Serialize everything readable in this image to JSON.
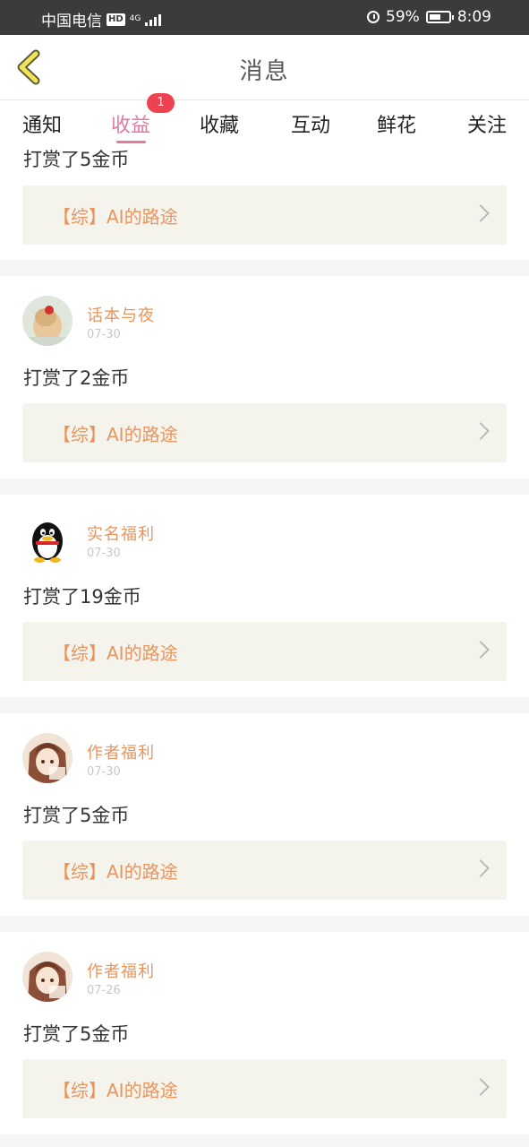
{
  "status_bar": {
    "carrier": "中国电信",
    "hd_label": "HD",
    "network": "4G",
    "battery_percent": "59%",
    "battery_level": 0.59,
    "time": "8:09",
    "icons": [
      "alarm-icon",
      "battery-icon",
      "signal-icon"
    ]
  },
  "header": {
    "title": "消息",
    "back_icon": "chevron-left-icon"
  },
  "tabs": [
    {
      "label": "通知"
    },
    {
      "label": "收益"
    },
    {
      "label": "收藏"
    },
    {
      "label": "互动"
    },
    {
      "label": "鲜花"
    },
    {
      "label": "关注"
    }
  ],
  "active_tab": "收益",
  "tab_badge": "1",
  "colors": {
    "accent_pink": "#e37aa0",
    "orange_text": "#e8955e",
    "badge_red": "#ef4250"
  },
  "feed": {
    "partial_top": {
      "message": "打赏了5金币",
      "book": "【综】AI的路途"
    },
    "items": [
      {
        "name": "话本与夜",
        "date": "07-30",
        "message": "打赏了2金币",
        "book": "【综】AI的路途"
      },
      {
        "name": "实名福利",
        "date": "07-30",
        "message": "打赏了19金币",
        "book": "【综】AI的路途"
      },
      {
        "name": "作者福利",
        "date": "07-30",
        "message": "打赏了5金币",
        "book": "【综】AI的路途"
      },
      {
        "name": "作者福利",
        "date": "07-26",
        "message": "打赏了5金币",
        "book": "【综】AI的路途"
      }
    ]
  }
}
